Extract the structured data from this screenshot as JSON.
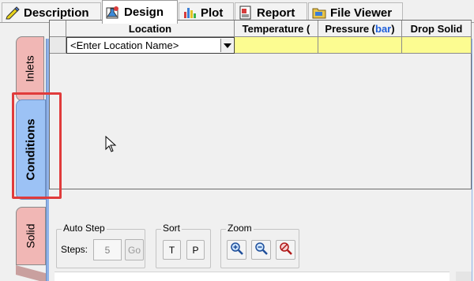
{
  "tabs": [
    {
      "label": "Description",
      "icon": "edit-pen-icon",
      "active": false
    },
    {
      "label": "Design",
      "icon": "design-flask-icon",
      "active": true
    },
    {
      "label": "Plot",
      "icon": "bar-chart-icon",
      "active": false
    },
    {
      "label": "Report",
      "icon": "report-icon",
      "active": false
    },
    {
      "label": "File Viewer",
      "icon": "folder-icon",
      "active": false
    }
  ],
  "side_tabs": [
    {
      "label": "Inlets",
      "active": false
    },
    {
      "label": "Conditions",
      "active": true
    },
    {
      "label": "Solid",
      "active": false
    }
  ],
  "grid": {
    "headers": {
      "location": "Location",
      "temperature": "Temperature (",
      "pressure_prefix": "Pressure (",
      "pressure_unit": "bar",
      "pressure_suffix": ")",
      "drop_solid": "Drop Solid"
    },
    "rows": [
      {
        "location": "<Enter Location Name>",
        "temperature": "",
        "pressure": "",
        "drop_solid": ""
      }
    ]
  },
  "auto_step": {
    "label": "Auto Step",
    "steps_label": "Steps:",
    "steps_value": "5",
    "go_label": "Go"
  },
  "sort": {
    "label": "Sort",
    "t_label": "T",
    "p_label": "P"
  },
  "zoom": {
    "label": "Zoom",
    "buttons": [
      "zoom-in-icon",
      "zoom-out-icon",
      "zoom-reset-icon"
    ]
  },
  "colors": {
    "panel_blue": "#8fb2e9",
    "active_side_tab": "#9cc2f5",
    "inactive_side_tab": "#f1b7b5",
    "input_yellow": "#fcfc91",
    "highlight_red": "#e03b3b",
    "unit_blue": "#1f5fd9"
  }
}
